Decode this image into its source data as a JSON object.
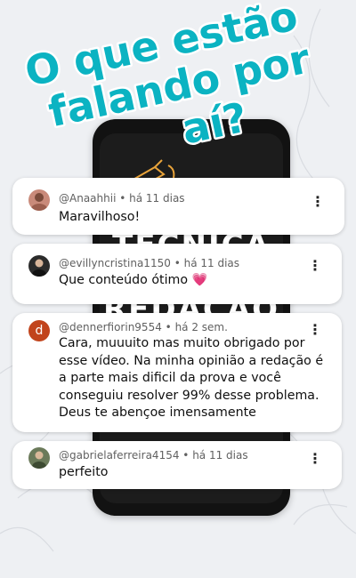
{
  "headline": {
    "line1": "O que estão",
    "line2": "falando por",
    "line3": "aí?"
  },
  "colors": {
    "headline_fill": "#0bb3c2",
    "headline_stroke": "#ffffff",
    "background": "#eef0f3",
    "heart": "#e91e63"
  },
  "phone": {
    "title_line1": "TÉCNICA DE",
    "title_line2": "REDAÇÃO"
  },
  "comments": [
    {
      "author": "@Anaahhii",
      "time": "há 11 dias",
      "text": "Maravilhoso!",
      "avatar_icon": "user-photo-avatar"
    },
    {
      "author": "@evillyncristina1150",
      "time": "há 11 dias",
      "text": "Que conteúdo ótimo 💗",
      "avatar_icon": "user-photo-avatar"
    },
    {
      "author": "@dennerfiorin9554",
      "time": "há 2 sem.",
      "text": "Cara, muuuito mas muito obrigado por esse vídeo. Na minha opinião a redação é a parte mais dificil da prova e você conseguiu resolver 99% desse problema. Deus te abençoe imensamente",
      "avatar_letter": "d",
      "avatar_color": "#c1441c"
    },
    {
      "author": "@gabrielaferreira4154",
      "time": "há 11 dias",
      "text": "perfeito",
      "avatar_icon": "user-photo-avatar"
    }
  ],
  "menu_icon": "more-vert-icon",
  "separator": "•"
}
